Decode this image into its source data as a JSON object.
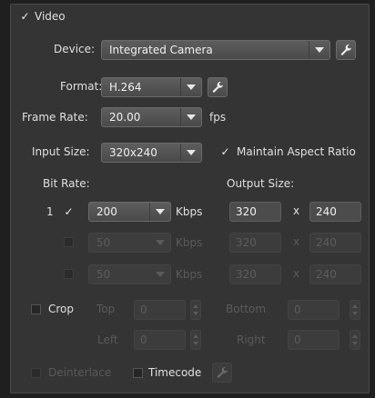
{
  "video": {
    "label": "Video",
    "checked": true
  },
  "device": {
    "label": "Device:",
    "value": "Integrated Camera"
  },
  "format": {
    "label": "Format:",
    "value": "H.264"
  },
  "frame_rate": {
    "label": "Frame Rate:",
    "value": "20.00",
    "unit": "fps"
  },
  "input_size": {
    "label": "Input Size:",
    "value": "320x240",
    "maintain_aspect_label": "Maintain Aspect Ratio",
    "maintain_aspect_checked": true
  },
  "bitrate_header": "Bit Rate:",
  "output_size_header": "Output Size:",
  "streams": [
    {
      "index": "1",
      "checked": true,
      "bitrate": "200",
      "unit": "Kbps",
      "width": "320",
      "sep": "x",
      "height": "240",
      "enabled": true
    },
    {
      "index": "",
      "checked": false,
      "bitrate": "50",
      "unit": "Kbps",
      "width": "320",
      "sep": "x",
      "height": "240",
      "enabled": false
    },
    {
      "index": "",
      "checked": false,
      "bitrate": "50",
      "unit": "Kbps",
      "width": "320",
      "sep": "x",
      "height": "240",
      "enabled": false
    }
  ],
  "crop": {
    "label": "Crop",
    "checked": false,
    "top_label": "Top",
    "top_value": "0",
    "bottom_label": "Bottom",
    "bottom_value": "0",
    "left_label": "Left",
    "left_value": "0",
    "right_label": "Right",
    "right_value": "0"
  },
  "deinterlace": {
    "label": "Deinterlace",
    "checked": false
  },
  "timecode": {
    "label": "Timecode",
    "checked": false
  }
}
